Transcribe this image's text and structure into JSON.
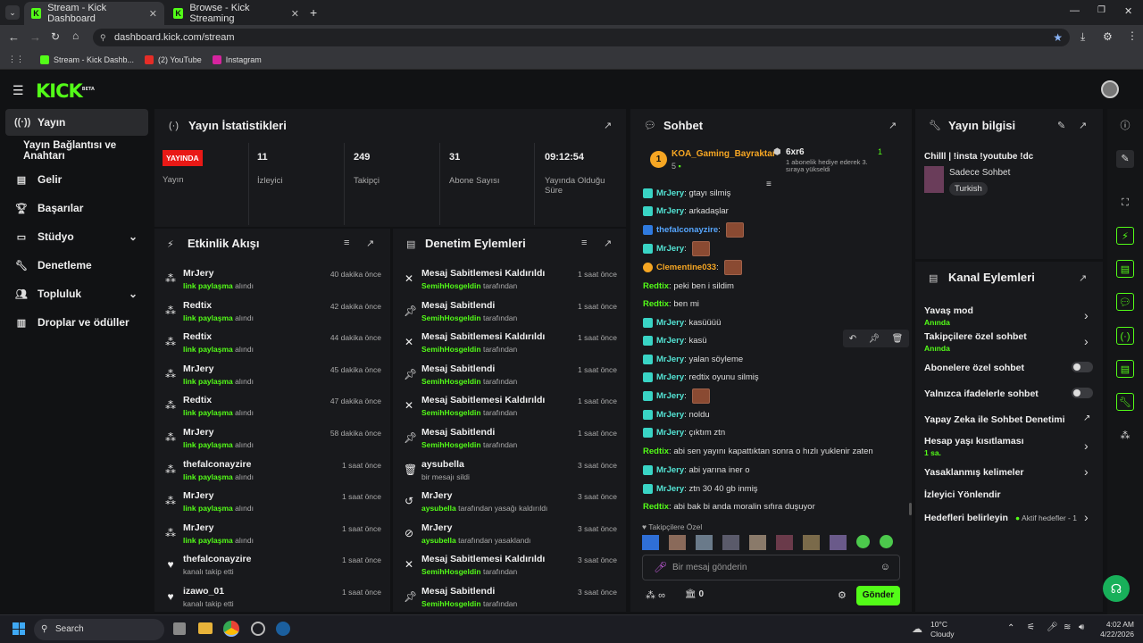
{
  "browser": {
    "tabs": [
      {
        "title": "Stream - Kick Dashboard"
      },
      {
        "title": "Browse - Kick Streaming"
      }
    ],
    "url": "dashboard.kick.com/stream",
    "bookmarks": [
      "Stream - Kick Dashb...",
      "(2) YouTube",
      "Instagram"
    ]
  },
  "app": {
    "logo": "KICK",
    "logo_badge": "BETA"
  },
  "sidebar": {
    "items": [
      {
        "label": "Yayın"
      },
      {
        "label": "Yayın Bağlantısı ve Anahtarı"
      },
      {
        "label": "Gelir"
      },
      {
        "label": "Başarılar"
      },
      {
        "label": "Stüdyo"
      },
      {
        "label": "Denetleme"
      },
      {
        "label": "Topluluk"
      },
      {
        "label": "Droplar ve ödüller"
      }
    ]
  },
  "stats": {
    "title": "Yayın İstatistikleri",
    "status": "YAYINDA",
    "status_label": "Yayın",
    "viewers": "11",
    "viewers_label": "İzleyici",
    "followers": "249",
    "followers_label": "Takipçi",
    "subs": "31",
    "subs_label": "Abone Sayısı",
    "uptime": "09:12:54",
    "uptime_label": "Yayında Olduğu Süre"
  },
  "activity": {
    "title": "Etkinlik Akışı",
    "rows": [
      {
        "user": "MrJery",
        "action": "link paylaşma",
        "suffix": "alındı",
        "time": "40 dakika önce",
        "icon": "gift"
      },
      {
        "user": "Redtix",
        "action": "link paylaşma",
        "suffix": "alındı",
        "time": "42 dakika önce",
        "icon": "gift"
      },
      {
        "user": "Redtix",
        "action": "link paylaşma",
        "suffix": "alındı",
        "time": "44 dakika önce",
        "icon": "gift"
      },
      {
        "user": "MrJery",
        "action": "link paylaşma",
        "suffix": "alındı",
        "time": "45 dakika önce",
        "icon": "gift"
      },
      {
        "user": "Redtix",
        "action": "link paylaşma",
        "suffix": "alındı",
        "time": "47 dakika önce",
        "icon": "gift"
      },
      {
        "user": "MrJery",
        "action": "link paylaşma",
        "suffix": "alındı",
        "time": "58 dakika önce",
        "icon": "gift"
      },
      {
        "user": "thefalconayzire",
        "action": "link paylaşma",
        "suffix": "alındı",
        "time": "1 saat önce",
        "icon": "gift"
      },
      {
        "user": "MrJery",
        "action": "link paylaşma",
        "suffix": "alındı",
        "time": "1 saat önce",
        "icon": "gift"
      },
      {
        "user": "MrJery",
        "action": "link paylaşma",
        "suffix": "alındı",
        "time": "1 saat önce",
        "icon": "gift"
      },
      {
        "user": "thefalconayzire",
        "action": "",
        "suffix": "kanalı takip etti",
        "time": "1 saat önce",
        "icon": "heart"
      },
      {
        "user": "izawo_01",
        "action": "",
        "suffix": "kanalı takip etti",
        "time": "1 saat önce",
        "icon": "heart"
      }
    ]
  },
  "moderation": {
    "title": "Denetim Eylemleri",
    "rows": [
      {
        "title": "Mesaj Sabitlemesi Kaldırıldı",
        "mod": "SemihHosgeldin",
        "suffix": "tarafından",
        "time": "1 saat önce",
        "icon": "unpin"
      },
      {
        "title": "Mesaj Sabitlendi",
        "mod": "SemihHosgeldin",
        "suffix": "tarafından",
        "time": "1 saat önce",
        "icon": "pin"
      },
      {
        "title": "Mesaj Sabitlemesi Kaldırıldı",
        "mod": "SemihHosgeldin",
        "suffix": "tarafından",
        "time": "1 saat önce",
        "icon": "unpin"
      },
      {
        "title": "Mesaj Sabitlendi",
        "mod": "SemihHosgeldin",
        "suffix": "tarafından",
        "time": "1 saat önce",
        "icon": "pin"
      },
      {
        "title": "Mesaj Sabitlemesi Kaldırıldı",
        "mod": "SemihHosgeldin",
        "suffix": "tarafından",
        "time": "1 saat önce",
        "icon": "unpin"
      },
      {
        "title": "Mesaj Sabitlendi",
        "mod": "SemihHosgeldin",
        "suffix": "tarafından",
        "time": "1 saat önce",
        "icon": "pin"
      },
      {
        "title": "aysubella",
        "mod": "",
        "suffix": "bir mesajı sildi",
        "time": "3 saat önce",
        "icon": "trash"
      },
      {
        "title": "MrJery",
        "mod": "aysubella",
        "suffix": "tarafından yasağı kaldırıldı",
        "time": "3 saat önce",
        "icon": "undo"
      },
      {
        "title": "MrJery",
        "mod": "aysubella",
        "suffix": "tarafından yasaklandı",
        "time": "3 saat önce",
        "icon": "ban"
      },
      {
        "title": "Mesaj Sabitlemesi Kaldırıldı",
        "mod": "SemihHosgeldin",
        "suffix": "tarafından",
        "time": "3 saat önce",
        "icon": "unpin"
      },
      {
        "title": "Mesaj Sabitlendi",
        "mod": "SemihHosgeldin",
        "suffix": "tarafından",
        "time": "3 saat önce",
        "icon": "pin"
      }
    ]
  },
  "chat": {
    "title": "Sohbet",
    "pinned_user": "KOA_Gaming_Bayraktar",
    "pinned_rank": "5",
    "gifter": "6xr6",
    "gifter_count": "1",
    "gift_note": "1 abonelik hediye ederek 3. sıraya yükseldi",
    "messages": [
      {
        "user": "MrJery",
        "text": "gtayı silmiş",
        "style": "teal",
        "emote": false
      },
      {
        "user": "MrJery",
        "text": "arkadaşlar",
        "style": "teal",
        "emote": false
      },
      {
        "user": "thefalconayzire",
        "text": "",
        "style": "blue",
        "emote": true
      },
      {
        "user": "MrJery",
        "text": "",
        "style": "teal",
        "emote": true
      },
      {
        "user": "Clementine033",
        "text": "",
        "style": "ora",
        "emote": true
      },
      {
        "user": "Redtix",
        "text": "peki ben i sildim",
        "style": "grn",
        "emote": false
      },
      {
        "user": "Redtix",
        "text": "ben mi",
        "style": "grn",
        "emote": false
      },
      {
        "user": "MrJery",
        "text": "kasüüüü",
        "style": "teal",
        "emote": false
      },
      {
        "user": "MrJery",
        "text": "kasü",
        "style": "teal",
        "emote": false
      },
      {
        "user": "MrJery",
        "text": "yalan söyleme",
        "style": "teal",
        "emote": false
      },
      {
        "user": "MrJery",
        "text": "redtix oyunu silmiş",
        "style": "teal",
        "emote": false
      },
      {
        "user": "MrJery",
        "text": "",
        "style": "teal",
        "emote": true
      },
      {
        "user": "MrJery",
        "text": "noldu",
        "style": "teal",
        "emote": false
      },
      {
        "user": "MrJery",
        "text": "çıktım ztn",
        "style": "teal",
        "emote": false
      },
      {
        "user": "Redtix",
        "text": "abi sen yayını kapattıktan sonra o hızlı yuklenir zaten",
        "style": "grn",
        "emote": false
      },
      {
        "user": "MrJery",
        "text": "abi yarına iner o",
        "style": "teal",
        "emote": false
      },
      {
        "user": "MrJery",
        "text": "ztn 30 40 gb inmiş",
        "style": "teal",
        "emote": false
      },
      {
        "user": "Redtix",
        "text": "abi bak bi anda moralin sıfıra duşuyor",
        "style": "grn",
        "emote": false
      }
    ],
    "followers_only": "Takipçilere Özel",
    "input_placeholder": "Bir mesaj gönderin",
    "points": "0",
    "send": "Gönder",
    "infinity": "∞"
  },
  "stream_info": {
    "title": "Yayın bilgisi",
    "stream_title": "Chilll | !insta !youtube !dc",
    "category": "Sadece Sohbet",
    "tag": "Turkish"
  },
  "channel_actions": {
    "title": "Kanal Eylemleri",
    "items": [
      {
        "label": "Yavaş mod",
        "sub": "Anında"
      },
      {
        "label": "Takipçilere özel sohbet",
        "sub": "Anında"
      },
      {
        "label": "Abonelere özel sohbet",
        "sub": ""
      },
      {
        "label": "Yalnızca ifadelerle sohbet",
        "sub": ""
      },
      {
        "label": "Yapay Zeka ile Sohbet Denetimi",
        "sub": ""
      },
      {
        "label": "Hesap yaşı kısıtlaması",
        "sub": "1 sa."
      },
      {
        "label": "Yasaklanmış kelimeler",
        "sub": ""
      },
      {
        "label": "İzleyici Yönlendir",
        "sub": ""
      },
      {
        "label": "Hedefleri belirleyin",
        "sub": ""
      }
    ],
    "goals_status": "Aktif hedefler - 1"
  },
  "taskbar": {
    "search": "Search",
    "weather_temp": "10°C",
    "weather_desc": "Cloudy",
    "time": "4:02 AM",
    "date": "4/22/2026"
  },
  "colors": {
    "accent": "#53fc18",
    "live": "#e91916",
    "panel": "#18191c"
  }
}
